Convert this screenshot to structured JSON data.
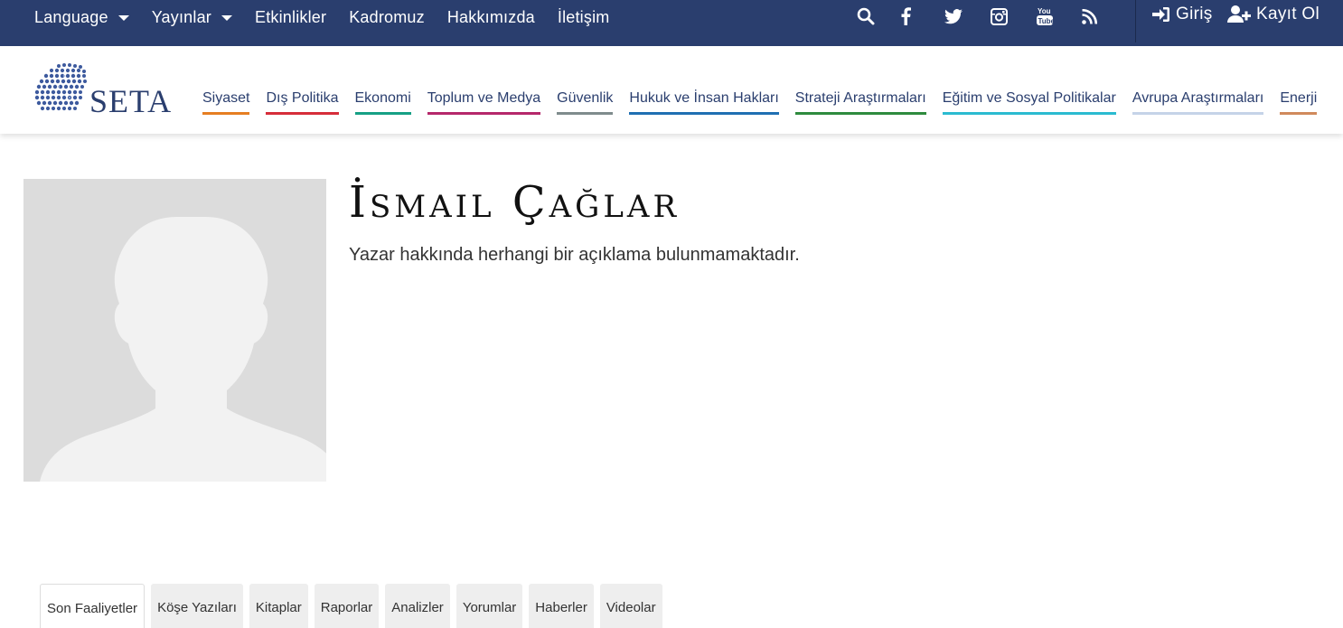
{
  "topnav": {
    "items": [
      {
        "label": "Language",
        "dropdown": true
      },
      {
        "label": "Yayınlar",
        "dropdown": true
      },
      {
        "label": "Etkinlikler",
        "dropdown": false
      },
      {
        "label": "Kadromuz",
        "dropdown": false
      },
      {
        "label": "Hakkımızda",
        "dropdown": false
      },
      {
        "label": "İletişim",
        "dropdown": false
      }
    ],
    "social_icons": [
      "search-icon",
      "facebook-icon",
      "twitter-icon",
      "instagram-icon",
      "youtube-icon",
      "rss-icon"
    ],
    "login_label": "Giriş",
    "register_label": "Kayıt Ol",
    "bg_color": "#2a3e6e"
  },
  "header": {
    "logo_text": "SETA",
    "categories": [
      {
        "label": "Siyaset",
        "color": "#e67e22"
      },
      {
        "label": "Dış Politika",
        "color": "#d62d3a"
      },
      {
        "label": "Ekonomi",
        "color": "#16a085"
      },
      {
        "label": "Toplum ve Medya",
        "color": "#b5286b"
      },
      {
        "label": "Güvenlik",
        "color": "#7f8c8d"
      },
      {
        "label": "Hukuk ve İnsan Hakları",
        "color": "#1f6fb2"
      },
      {
        "label": "Strateji Araştırmaları",
        "color": "#2e8b3e"
      },
      {
        "label": "Eğitim ve Sosyal Politikalar",
        "color": "#2bbbd0"
      },
      {
        "label": "Avrupa Araştırmaları",
        "color": "#c5d3e8"
      },
      {
        "label": "Enerji",
        "color": "#d08a5c"
      }
    ]
  },
  "author": {
    "name": "İsmail Çağlar",
    "description": "Yazar hakkında herhangi bir açıklama bulunmamaktadır."
  },
  "tabs": [
    {
      "label": "Son Faaliyetler",
      "active": true
    },
    {
      "label": "Köşe Yazıları",
      "active": false
    },
    {
      "label": "Kitaplar",
      "active": false
    },
    {
      "label": "Raporlar",
      "active": false
    },
    {
      "label": "Analizler",
      "active": false
    },
    {
      "label": "Yorumlar",
      "active": false
    },
    {
      "label": "Haberler",
      "active": false
    },
    {
      "label": "Videolar",
      "active": false
    }
  ]
}
